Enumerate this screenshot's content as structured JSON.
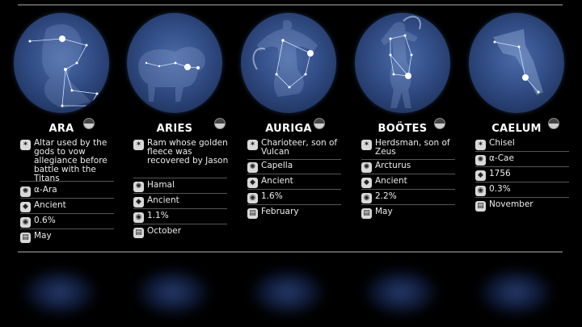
{
  "constellations": [
    {
      "name": "ARA",
      "meaning": "Altar used by the gods to vow allegiance before battle with the Titans",
      "brightest_star": "α-Ara",
      "origin": "Ancient",
      "sky_area": "0.6%",
      "best_month": "May"
    },
    {
      "name": "ARIES",
      "meaning": "Ram whose golden fleece was recovered by Jason",
      "brightest_star": "Hamal",
      "origin": "Ancient",
      "sky_area": "1.1%",
      "best_month": "October"
    },
    {
      "name": "AURIGA",
      "meaning": "Charioteer, son of Vulcan",
      "brightest_star": "Capella",
      "origin": "Ancient",
      "sky_area": "1.6%",
      "best_month": "February"
    },
    {
      "name": "BOÖTES",
      "meaning": "Herdsman, son of Zeus",
      "brightest_star": "Arcturus",
      "origin": "Ancient",
      "sky_area": "2.2%",
      "best_month": "May"
    },
    {
      "name": "CAELUM",
      "meaning": "Chisel",
      "brightest_star": "α-Cae",
      "origin": "1756",
      "sky_area": "0.3%",
      "best_month": "November"
    }
  ],
  "icons": {
    "meaning": "info-icon",
    "brightest_star": "star-icon",
    "origin": "origin-icon",
    "sky_area": "area-icon",
    "best_month": "calendar-icon",
    "hemisphere": "hemisphere-icon"
  },
  "colors": {
    "background": "#000000",
    "globe": "#34508a",
    "text": "#ececec"
  }
}
